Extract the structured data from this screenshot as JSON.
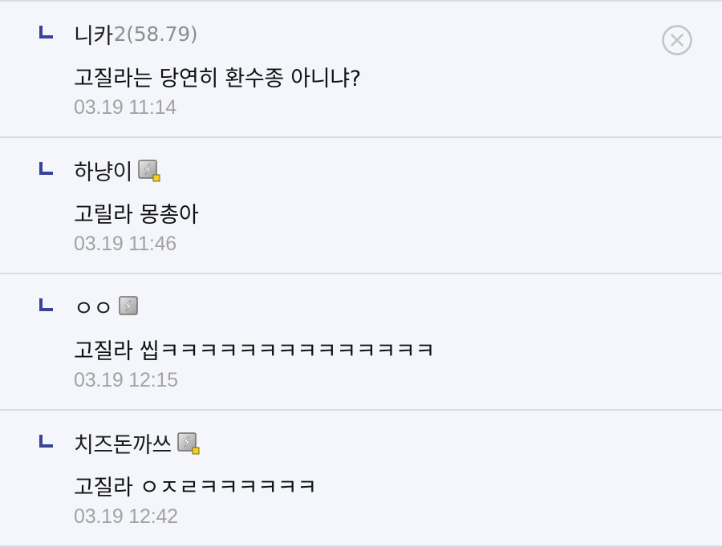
{
  "comments": [
    {
      "nickname": "니카",
      "nick_suffix": "2(58.79)",
      "body": "고질라는 당연히 환수종 아니냐?",
      "time": "03.19 11:14",
      "badge": null,
      "close_icon": "close-circle-icon"
    },
    {
      "nickname": "하냥이",
      "nick_suffix": "",
      "body": "고릴라 몽총아",
      "time": "03.19 11:46",
      "badge": "fixed-nick-badge-icon"
    },
    {
      "nickname": "ㅇㅇ",
      "nick_suffix": "",
      "body": "고질라 씹ㅋㅋㅋㅋㅋㅋㅋㅋㅋㅋㅋㅋㅋㅋ",
      "time": "03.19 12:15",
      "badge": "half-fixed-nick-badge-icon"
    },
    {
      "nickname": "치즈돈까쓰",
      "nick_suffix": "",
      "body": "고질라 ㅇㅈㄹㅋㅋㅋㅋㅋㅋ",
      "time": "03.19 12:42",
      "badge": "fixed-nick-badge-icon"
    }
  ],
  "colors": {
    "background": "#f4f6fb",
    "divider": "#d9dde8",
    "reply_marker": "#3b4399",
    "timestamp": "#a3a3a3",
    "badge_dot": "#f2d21b"
  }
}
